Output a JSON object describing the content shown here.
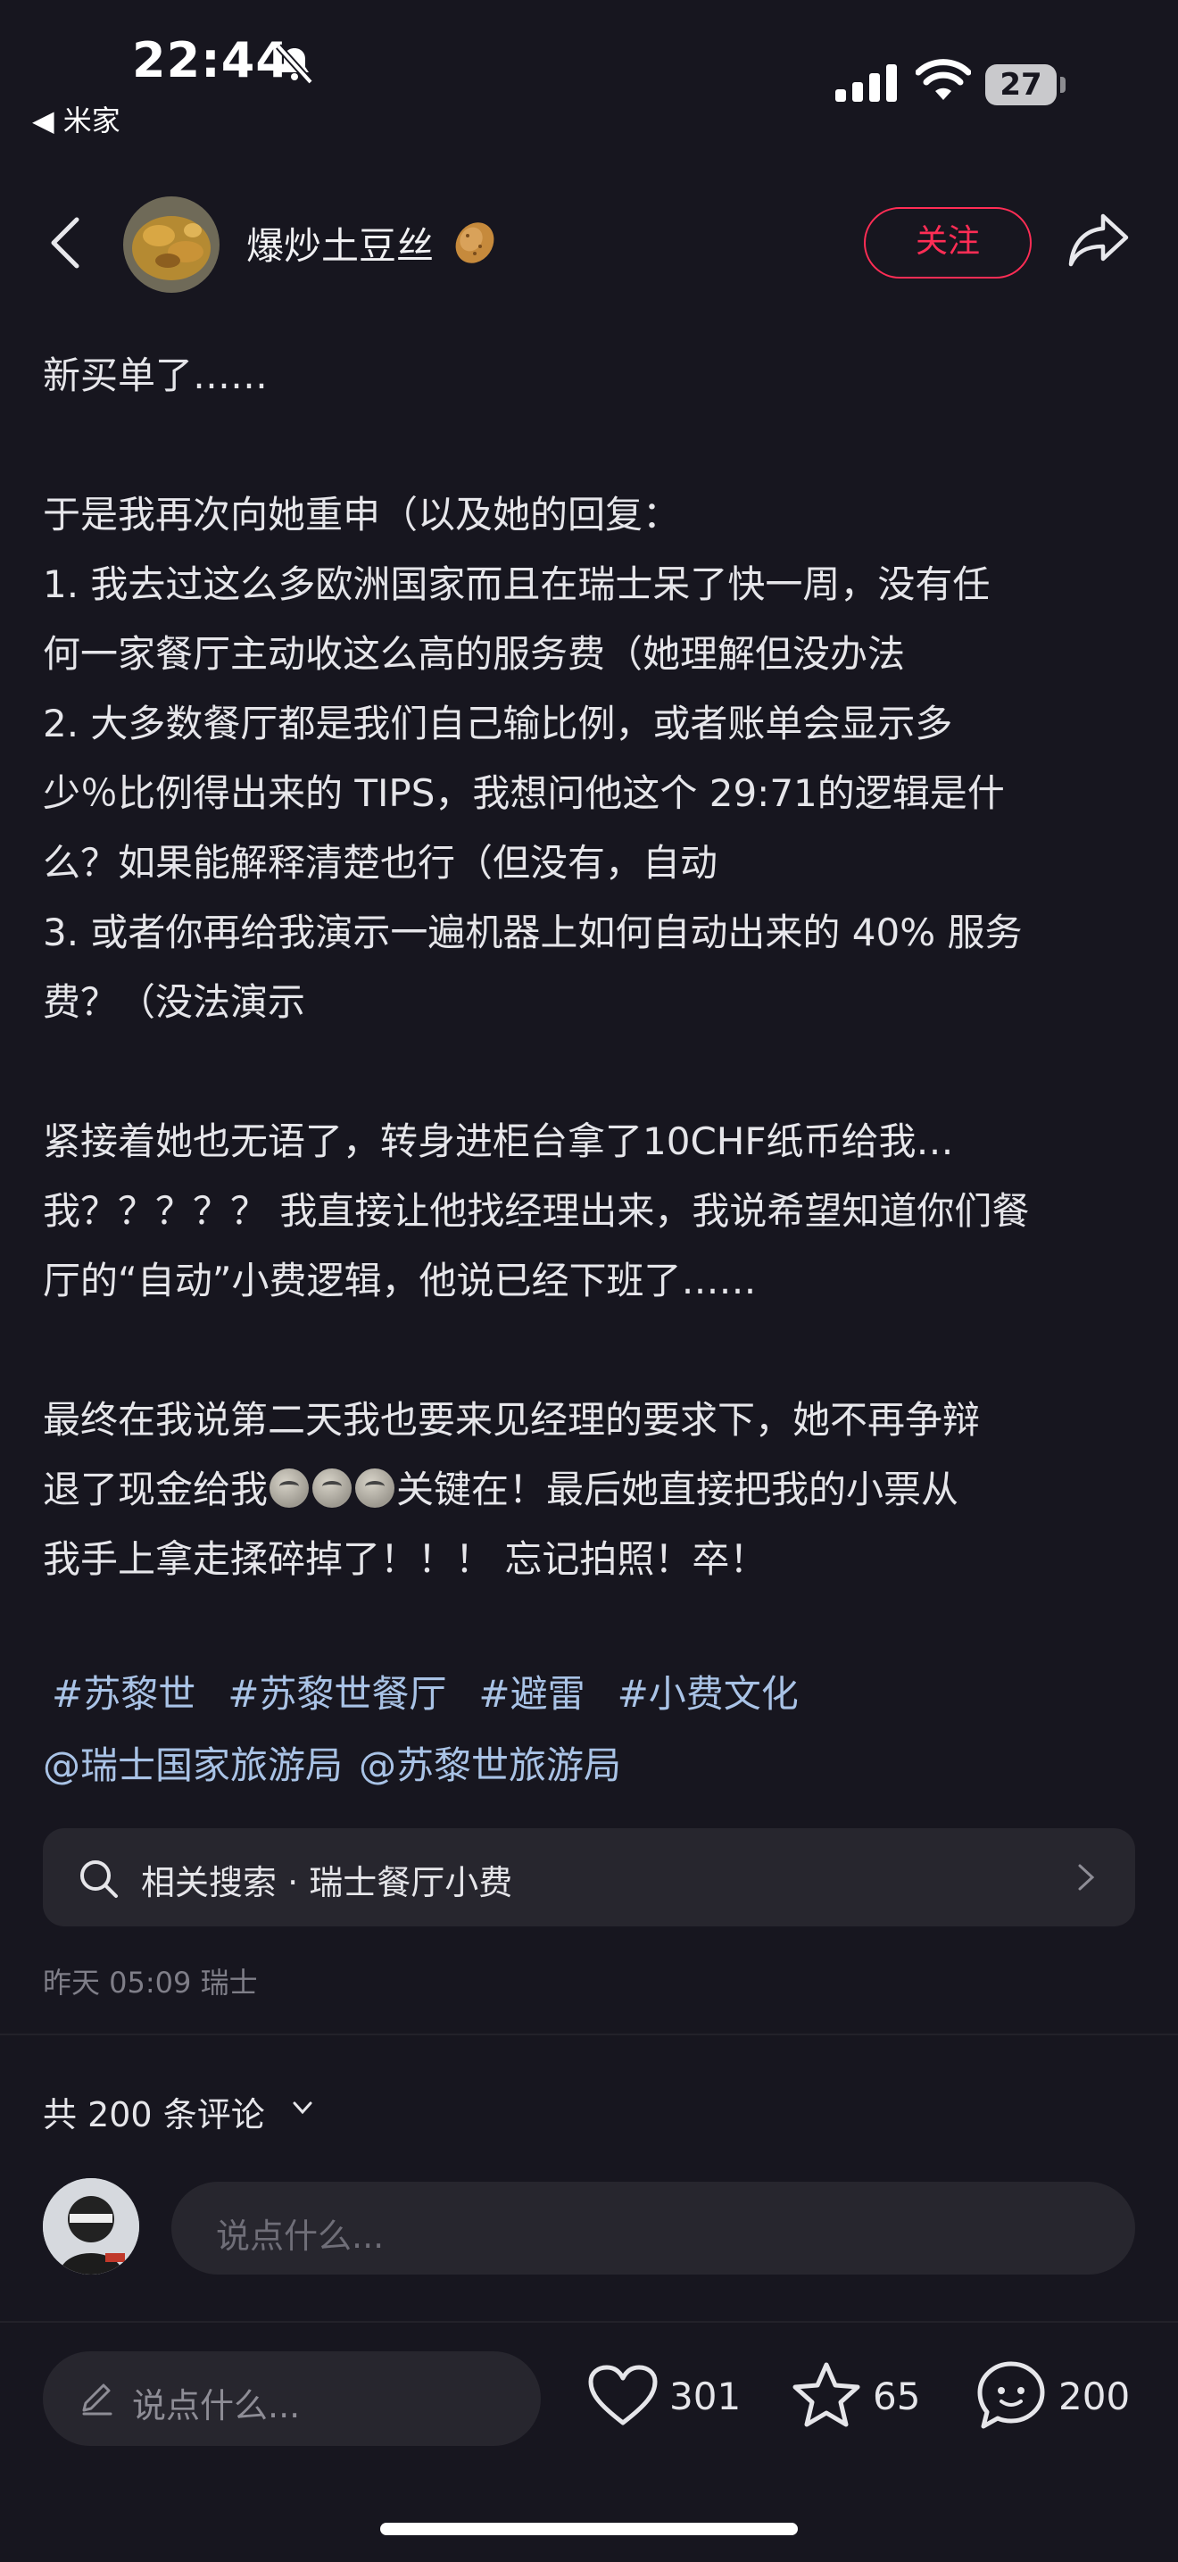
{
  "status_bar": {
    "time": "22:44",
    "back_app": "◀ 米家",
    "battery": "27"
  },
  "header": {
    "author": "爆炒土豆丝",
    "follow": "关注"
  },
  "post": {
    "line1": "新买单了……",
    "p2": [
      "于是我再次向她重申（以及她的回复：",
      "1. 我去过这么多欧洲国家而且在瑞士呆了快一周，没有任",
      "何一家餐厅主动收这么高的服务费（她理解但没办法",
      "2. 大多数餐厅都是我们自己输比例，或者账单会显示多",
      "少％比例得出来的 TIPS，我想问他这个 29:71的逻辑是什",
      "么？如果能解释清楚也行（但没有，自动",
      "3. 或者你再给我演示一遍机器上如何自动出来的 40% 服务",
      "费？（没法演示"
    ],
    "p3": [
      "紧接着她也无语了，转身进柜台拿了10CHF纸币给我…",
      "我？？？？？ 我直接让他找经理出来，我说希望知道你们餐",
      "厅的“自动”小费逻辑，他说已经下班了……"
    ],
    "p4_line1": "最终在我说第二天我也要来见经理的要求下，她不再争辩",
    "p4_line2a": "退了现金给我",
    "p4_line2b": "关键在！最后她直接把我的小票从",
    "p4_line3": "我手上拿走揉碎掉了！！！ 忘记拍照！卒！"
  },
  "tags": [
    "#苏黎世",
    "#苏黎世餐厅",
    "#避雷",
    "#小费文化"
  ],
  "mentions": [
    "@瑞士国家旅游局",
    "@苏黎世旅游局"
  ],
  "related_search": "相关搜索 · 瑞士餐厅小费",
  "meta": "昨天 05:09 瑞士",
  "comments": {
    "count_label": "共 200 条评论",
    "placeholder": "说点什么..."
  },
  "bottom": {
    "placeholder": "说点什么...",
    "likes": "301",
    "stars": "65",
    "comments": "200"
  }
}
